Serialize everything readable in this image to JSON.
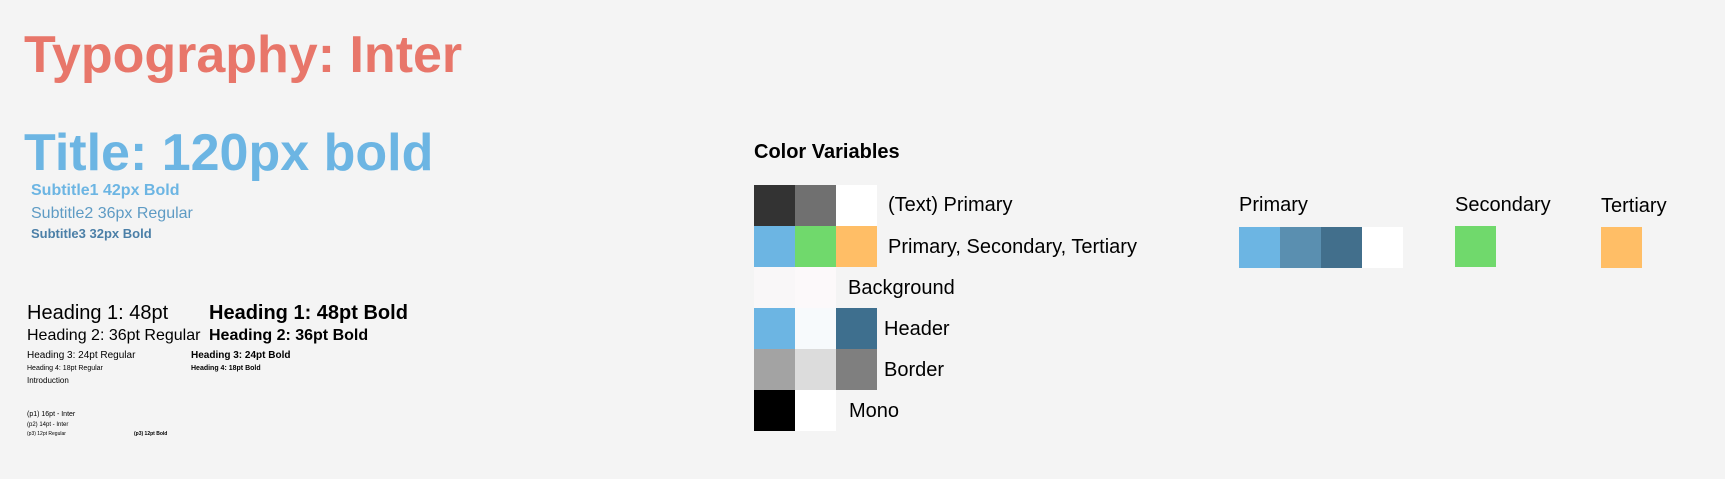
{
  "colors": {
    "title_red": "#e8766a",
    "title_blue": "#6cb5e3",
    "subtitle_blue": "#5e9bc4",
    "subtitle3_blue": "#4b7fa7",
    "background": "#f4f4f4"
  },
  "typography": {
    "main_title": "Typography: Inter",
    "big_title": "Title: 120px bold",
    "subtitle1": "Subtitle1 42px Bold",
    "subtitle2": "Subtitle2 36px Regular",
    "subtitle3": "Subtitle3 32px Bold",
    "regular": {
      "h1": "Heading 1: 48pt",
      "h2": "Heading 2: 36pt Regular",
      "h3": "Heading 3: 24pt Regular",
      "h4": "Heading 4: 18pt Regular"
    },
    "bold": {
      "h1": "Heading 1: 48pt Bold",
      "h2": "Heading 2: 36pt Bold",
      "h3": "Heading 3: 24pt Bold",
      "h4": "Heading 4: 18pt Bold"
    },
    "introduction": "Introduction",
    "p1": "(p1) 16pt - Inter",
    "p2": "(p2) 14pt - Inter",
    "p3_regular": "(p3) 12pt Regular",
    "p3_bold": "(p3) 12pt Bold"
  },
  "color_variables": {
    "title": "Color Variables",
    "rows": [
      {
        "label": "(Text) Primary",
        "swatches": [
          "#333333",
          "#707070",
          "#ffffff"
        ]
      },
      {
        "label": "Primary, Secondary, Tertiary",
        "swatches": [
          "#6cb5e3",
          "#70d96c",
          "#ffbe66"
        ]
      },
      {
        "label": "Background",
        "swatches": [
          "#f9f7f8",
          "#fcf9fa"
        ]
      },
      {
        "label": "Header",
        "swatches": [
          "#6cb5e3",
          "#f7fafc",
          "#3e6f8e"
        ]
      },
      {
        "label": "Border",
        "swatches": [
          "#a3a3a3",
          "#dcdcdc",
          "#7f7f7f"
        ]
      },
      {
        "label": "Mono",
        "swatches": [
          "#000000",
          "#ffffff"
        ]
      }
    ],
    "groups": {
      "primary": {
        "label": "Primary",
        "swatches": [
          "#6cb5e3",
          "#5a8fb0",
          "#426f8c",
          "#ffffff"
        ]
      },
      "secondary": {
        "label": "Secondary",
        "swatches": [
          "#70d96c"
        ]
      },
      "tertiary": {
        "label": "Tertiary",
        "swatches": [
          "#ffbe66"
        ]
      }
    }
  }
}
